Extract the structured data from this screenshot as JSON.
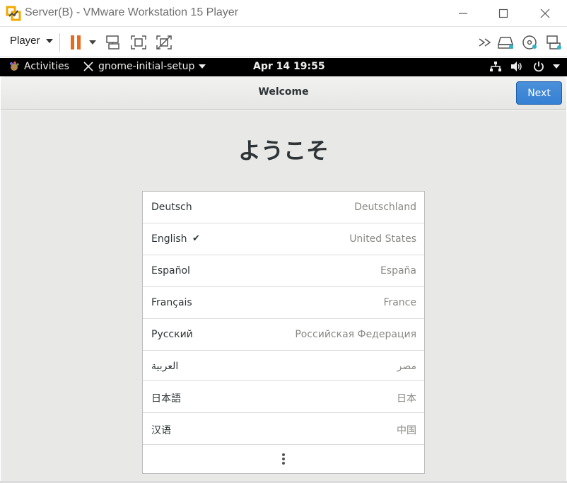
{
  "window": {
    "title": "Server(B) - VMware Workstation 15 Player",
    "app_icon": "vmware-icon",
    "controls": [
      "minimize-icon",
      "maximize-icon",
      "close-icon"
    ]
  },
  "toolbar": {
    "player_label": "Player",
    "icons": [
      "pause-icon",
      "dropdown-arrow-icon",
      "send-ctrl-alt-del-icon",
      "fit-guest-icon",
      "unity-icon",
      "fast-forward-icon",
      "hard-disk-icon",
      "cd-dvd-icon",
      "network-adapter-icon"
    ],
    "accent": "#e86a1e"
  },
  "gnome_bar": {
    "activities": "Activities",
    "app_menu": "gnome-initial-setup",
    "clock": "Apr 14  19:55",
    "status_icons": [
      "network-icon",
      "volume-icon",
      "power-icon"
    ]
  },
  "header": {
    "title": "Welcome",
    "next_label": "Next",
    "accent": "#3a85d6"
  },
  "welcome_text": "ようこそ",
  "languages": [
    {
      "name": "Deutsch",
      "region": "Deutschland",
      "selected": false
    },
    {
      "name": "English",
      "region": "United States",
      "selected": true,
      "check": "✔"
    },
    {
      "name": "Español",
      "region": "España",
      "selected": false
    },
    {
      "name": "Français",
      "region": "France",
      "selected": false
    },
    {
      "name": "Русский",
      "region": "Российская Федерация",
      "selected": false
    },
    {
      "name": "العربية",
      "region": "مصر",
      "selected": false
    },
    {
      "name": "日本語",
      "region": "日本",
      "selected": false
    },
    {
      "name": "汉语",
      "region": "中国",
      "selected": false
    }
  ],
  "more_icon": "view-more-icon"
}
